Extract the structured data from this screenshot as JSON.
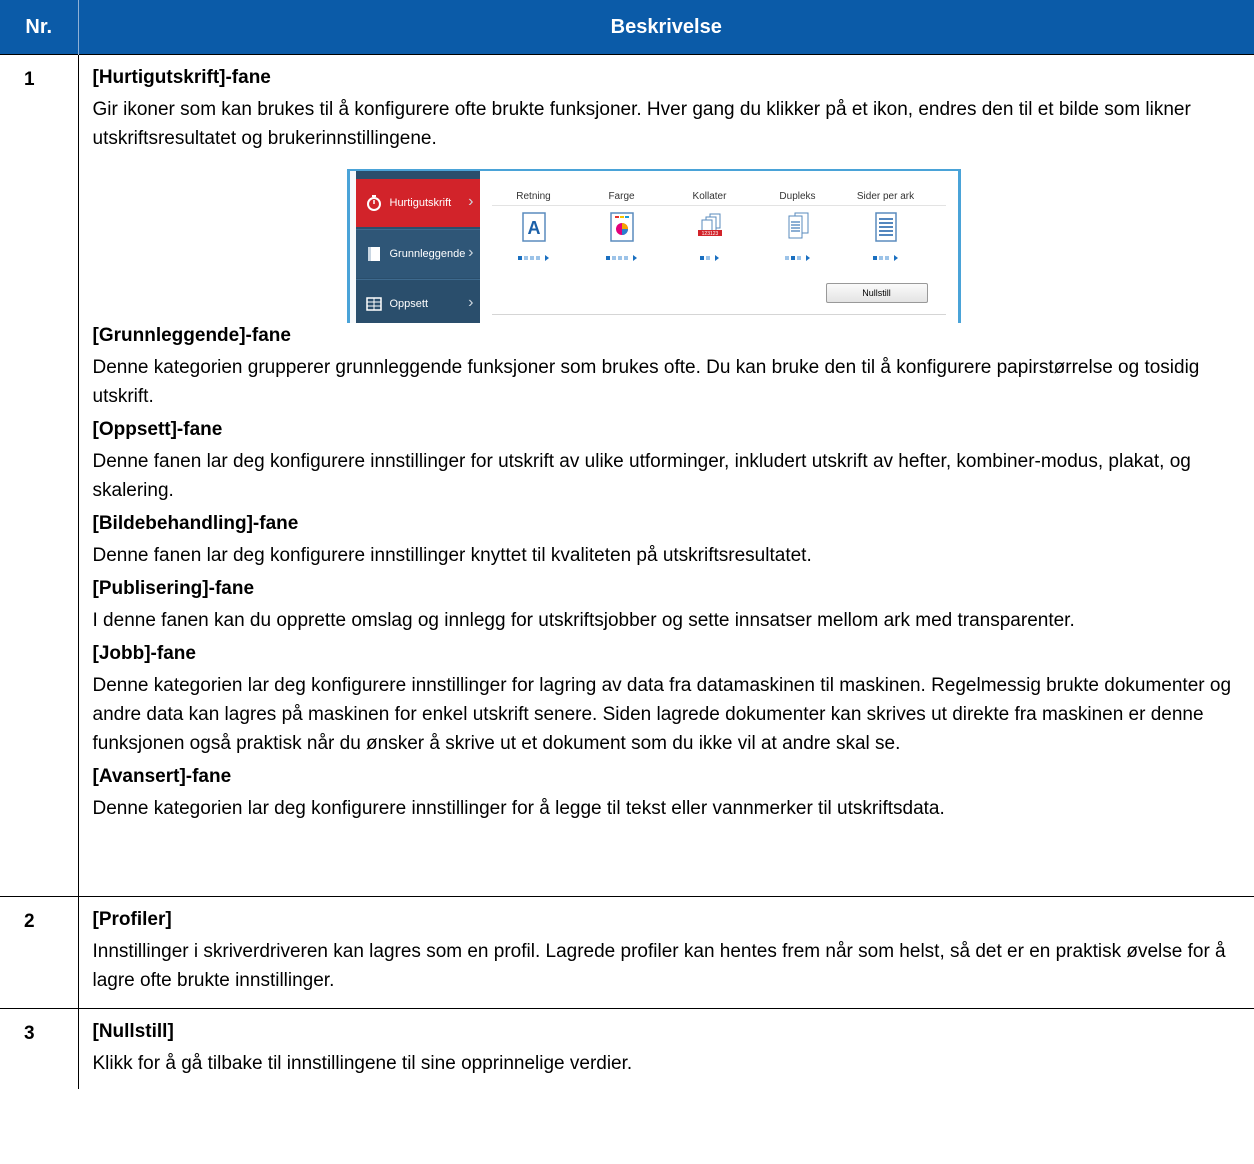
{
  "header": {
    "nr": "Nr.",
    "description": "Beskrivelse"
  },
  "colors": {
    "header_bg": "#0b5ba8",
    "tab_active": "#d2232a",
    "sidebar": "#2a4e6c"
  },
  "rows": [
    {
      "nr": "1",
      "sections": [
        {
          "heading": "[Hurtigutskrift]-fane",
          "text": "Gir ikoner som kan brukes til å konfigurere ofte brukte funksjoner. Hver gang du klikker på et ikon, endres den til et bilde som likner utskriftsresultatet og brukerinnstillingene."
        },
        {
          "heading": "[Grunnleggende]-fane",
          "text": "Denne kategorien grupperer grunnleggende funksjoner som brukes ofte. Du kan bruke den til å konfigurere papirstørrelse og tosidig utskrift."
        },
        {
          "heading": "[Oppsett]-fane",
          "text": "Denne fanen lar deg konfigurere innstillinger for utskrift av ulike utforminger, inkludert utskrift av hefter, kombiner-modus, plakat, og skalering."
        },
        {
          "heading": "[Bildebehandling]-fane",
          "text": "Denne fanen lar deg konfigurere innstillinger knyttet til kvaliteten på utskriftsresultatet."
        },
        {
          "heading": "[Publisering]-fane",
          "text": "I denne fanen kan du opprette omslag og innlegg for utskriftsjobber og sette innsatser mellom ark med transparenter."
        },
        {
          "heading": "[Jobb]-fane",
          "text": "Denne kategorien lar deg konfigurere innstillinger for lagring av data fra datamaskinen til maskinen. Regelmessig brukte dokumenter og andre data kan lagres på maskinen for enkel utskrift senere. Siden lagrede dokumenter kan skrives ut direkte fra maskinen er denne funksjonen også praktisk når du ønsker å skrive ut et dokument som du ikke vil at andre skal se."
        },
        {
          "heading": "[Avansert]-fane",
          "text": "Denne kategorien lar deg konfigurere innstillinger for å legge til tekst eller vannmerker til utskriftsdata."
        }
      ]
    },
    {
      "nr": "2",
      "heading": "[Profiler]",
      "text": "Innstillinger i skriverdriveren kan lagres som en profil. Lagrede profiler kan hentes frem når som helst, så det er en praktisk øvelse for å lagre ofte brukte innstillinger."
    },
    {
      "nr": "3",
      "heading": "[Nullstill]",
      "text": "Klikk for å gå tilbake til innstillingene til sine opprinnelige verdier."
    }
  ],
  "screenshot": {
    "tabs": [
      {
        "label": "Hurtigutskrift",
        "icon": "stopwatch-icon"
      },
      {
        "label": "Grunnleggende",
        "icon": "document-icon"
      },
      {
        "label": "Oppsett",
        "icon": "layout-grid-icon"
      }
    ],
    "options": [
      {
        "label": "Retning",
        "icon": "orientation-icon"
      },
      {
        "label": "Farge",
        "icon": "color-icon"
      },
      {
        "label": "Kollater",
        "icon": "collate-icon"
      },
      {
        "label": "Dupleks",
        "icon": "duplex-icon"
      },
      {
        "label": "Sider per ark",
        "icon": "pages-per-sheet-icon"
      }
    ],
    "reset_label": "Nullstill"
  }
}
